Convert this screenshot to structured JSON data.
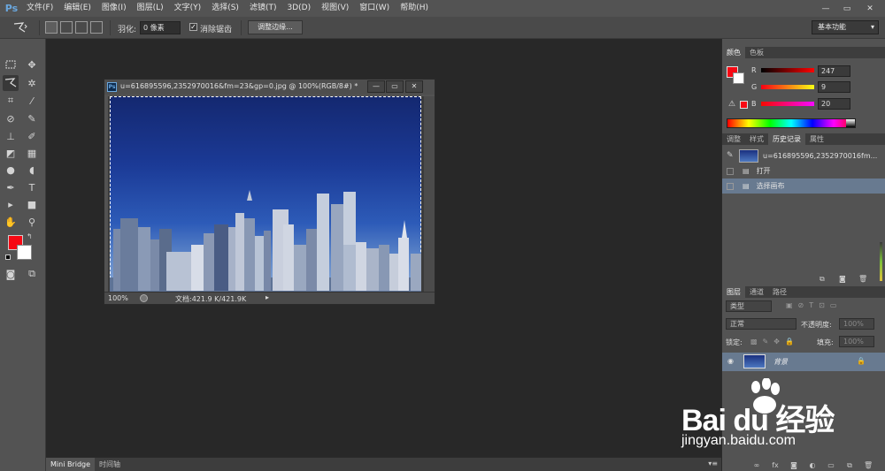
{
  "app": {
    "logo": "Ps"
  },
  "menu": [
    "文件(F)",
    "编辑(E)",
    "图像(I)",
    "图层(L)",
    "文字(Y)",
    "选择(S)",
    "滤镜(T)",
    "3D(D)",
    "视图(V)",
    "窗口(W)",
    "帮助(H)"
  ],
  "window_controls": {
    "minimize": "—",
    "maximize": "▭",
    "close": "✕"
  },
  "options": {
    "feather_label": "羽化:",
    "feather_value": "0 像素",
    "antialias_checked": true,
    "antialias_label": "消除锯齿",
    "refine_edge_label": "调整边缘...",
    "workspace_label": "基本功能"
  },
  "tools": {
    "foreground_color": "#f70914",
    "background_color": "#ffffff"
  },
  "document": {
    "ps_icon": "Ps",
    "title": "u=616895596,2352970016&fm=23&gp=0.jpg @ 100%(RGB/8#) *",
    "zoom": "100%",
    "doc_info": "文档:421.9 K/421.9K",
    "controls": {
      "minimize": "—",
      "restore": "▭",
      "close": "✕"
    }
  },
  "color_panel": {
    "tabs": [
      "颜色",
      "色板"
    ],
    "channels": [
      {
        "label": "R",
        "value": "247"
      },
      {
        "label": "G",
        "value": "9"
      },
      {
        "label": "B",
        "value": "20"
      }
    ]
  },
  "history_panel": {
    "tabs": [
      "调整",
      "样式",
      "历史记录",
      "属性"
    ],
    "snapshot_name": "u=616895596,2352970016fm...",
    "items": [
      {
        "label": "打开",
        "selected": false
      },
      {
        "label": "选择画布",
        "selected": true
      }
    ]
  },
  "layers_panel": {
    "tabs": [
      "图层",
      "通道",
      "路径"
    ],
    "filter_label": "类型",
    "blend_mode": "正常",
    "opacity_label": "不透明度:",
    "opacity_value": "100%",
    "lock_label": "锁定:",
    "fill_label": "填充:",
    "fill_value": "100%",
    "layer_name": "背景"
  },
  "bottom_panel": {
    "tabs": [
      "Mini Bridge",
      "时间轴"
    ]
  },
  "watermark": {
    "text": "Bai du 经验",
    "url": "jingyan.baidu.com"
  }
}
